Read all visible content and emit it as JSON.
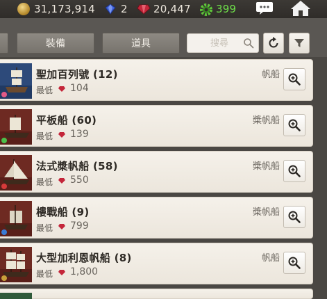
{
  "resources": {
    "gold": "31,173,914",
    "sapphire": "2",
    "ruby": "20,447",
    "cog": "399"
  },
  "filter": {
    "tab_equipment": "裝備",
    "tab_items": "道具",
    "search_placeholder": "搜尋"
  },
  "colors": {
    "cog_value": "#6fe04a",
    "row_bg": "#f2eee7",
    "background": "#4a4743"
  },
  "price_label": "最低",
  "ships": [
    {
      "name": "聖加百列號 (12)",
      "type": "帆船",
      "price": "104"
    },
    {
      "name": "平板船 (60)",
      "type": "槳帆船",
      "price": "139"
    },
    {
      "name": "法式槳帆船 (58)",
      "type": "槳帆船",
      "price": "550"
    },
    {
      "name": "樓戰船 (9)",
      "type": "槳帆船",
      "price": "799"
    },
    {
      "name": "大型加利恩帆船 (8)",
      "type": "帆船",
      "price": "1,800"
    },
    {
      "name": "",
      "type": "",
      "price": ""
    }
  ],
  "icons": {
    "gold": "gold-coin-icon",
    "sapphire": "sapphire-icon",
    "ruby": "ruby-icon",
    "cog": "gear-icon",
    "chat": "chat-bubble-icon",
    "home": "home-icon",
    "search": "search-icon",
    "refresh": "refresh-icon",
    "filter": "filter-funnel-icon",
    "inspect": "magnify-icon"
  }
}
